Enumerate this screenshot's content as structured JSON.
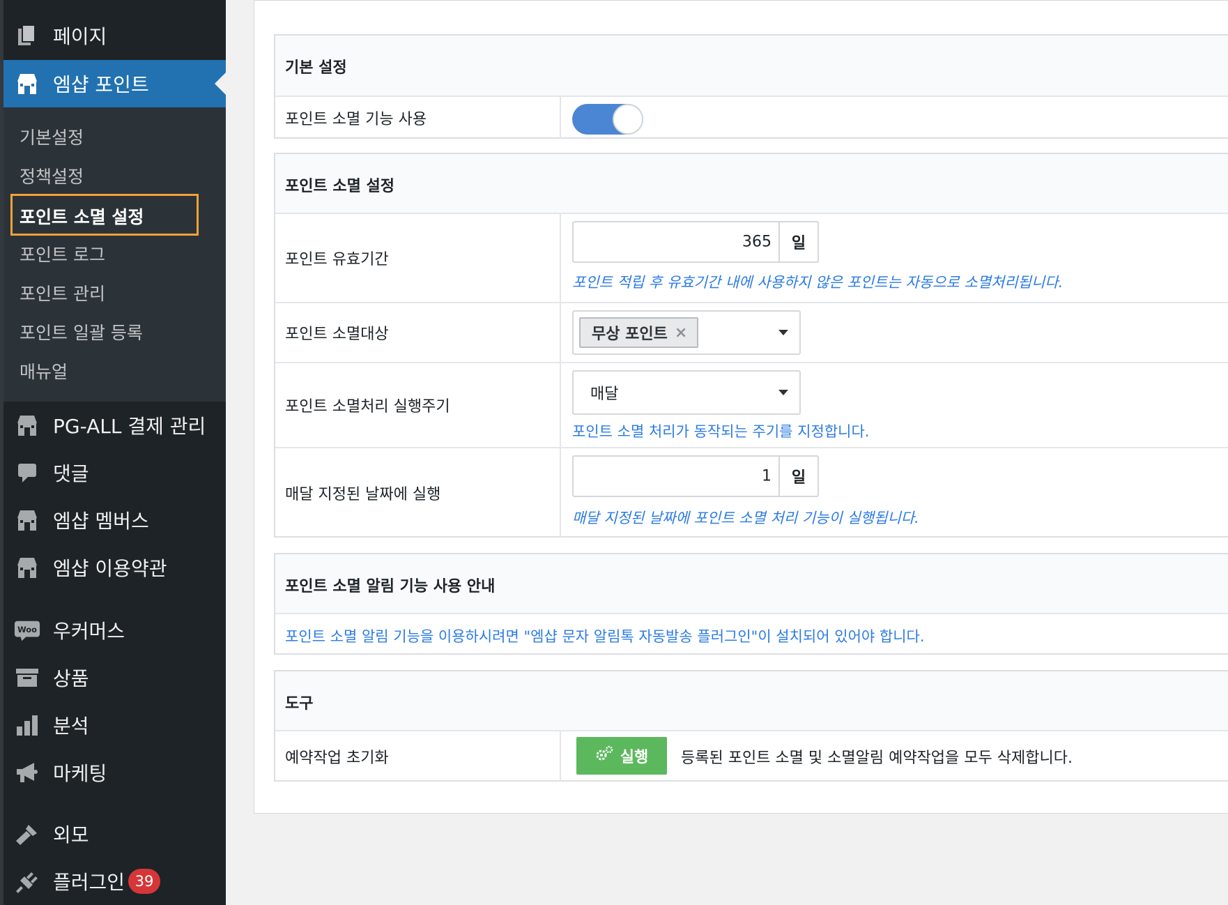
{
  "sidebar": {
    "top_items": [
      {
        "label": "페이지",
        "icon": "pages-icon"
      },
      {
        "label": "엠샵 포인트",
        "icon": "shop-icon",
        "current": true
      }
    ],
    "submenu": [
      {
        "label": "기본설정"
      },
      {
        "label": "정책설정"
      },
      {
        "label": "포인트 소멸 설정",
        "active": true
      },
      {
        "label": "포인트 로그"
      },
      {
        "label": "포인트 관리"
      },
      {
        "label": "포인트 일괄 등록"
      },
      {
        "label": "매뉴얼"
      }
    ],
    "items": [
      {
        "label": "PG-ALL 결제 관리",
        "icon": "shop-icon"
      },
      {
        "label": "댓글",
        "icon": "comment-icon"
      },
      {
        "label": "엠샵 멤버스",
        "icon": "shop-icon"
      },
      {
        "label": "엠샵 이용약관",
        "icon": "shop-icon"
      },
      {
        "label": "우커머스",
        "icon": "woo-icon",
        "icon_text": "Woo"
      },
      {
        "label": "상품",
        "icon": "archive-icon"
      },
      {
        "label": "분석",
        "icon": "bar-chart-icon"
      },
      {
        "label": "마케팅",
        "icon": "megaphone-icon"
      },
      {
        "label": "외모",
        "icon": "brush-icon"
      },
      {
        "label": "플러그인",
        "icon": "plugin-icon",
        "badge": "39"
      }
    ],
    "colors": {
      "bg": "#1d2327",
      "current": "#2271b1",
      "highlight": "#f0a23a",
      "badge": "#d63638"
    }
  },
  "sections": {
    "basic": {
      "title": "기본 설정",
      "rows": [
        {
          "label": "포인트 소멸 기능 사용",
          "toggle_on": true
        }
      ]
    },
    "expire": {
      "title": "포인트 소멸 설정",
      "validity": {
        "label": "포인트 유효기간",
        "value": "365",
        "unit": "일",
        "hint": "포인트 적립 후 유효기간 내에 사용하지 않은 포인트는 자동으로 소멸처리됩니다."
      },
      "target": {
        "label": "포인트 소멸대상",
        "chip": "무상 포인트",
        "chip_remove": "×"
      },
      "cycle": {
        "label": "포인트 소멸처리 실행주기",
        "selected": "매달",
        "hint": "포인트 소멸 처리가 동작되는 주기를 지정합니다."
      },
      "monthly_day": {
        "label": "매달 지정된 날짜에 실행",
        "value": "1",
        "unit": "일",
        "hint": "매달 지정된 날짜에 포인트 소멸 처리 기능이 실행됩니다."
      }
    },
    "notice": {
      "title": "포인트 소멸 알림 기능 사용 안내",
      "text": "포인트 소멸 알림 기능을 이용하시려면 \"엠샵 문자 알림톡 자동발송 플러그인\"이 설치되어 있어야 합니다."
    },
    "tools": {
      "title": "도구",
      "reset": {
        "label": "예약작업 초기화",
        "button": "실행",
        "description": "등록된 포인트 소멸 및 소멸알림 예약작업을 모두 삭제합니다."
      }
    }
  },
  "colors": {
    "toggle": "#4a86d4",
    "hint": "#2c7be5",
    "run_button": "#5cb85c"
  }
}
